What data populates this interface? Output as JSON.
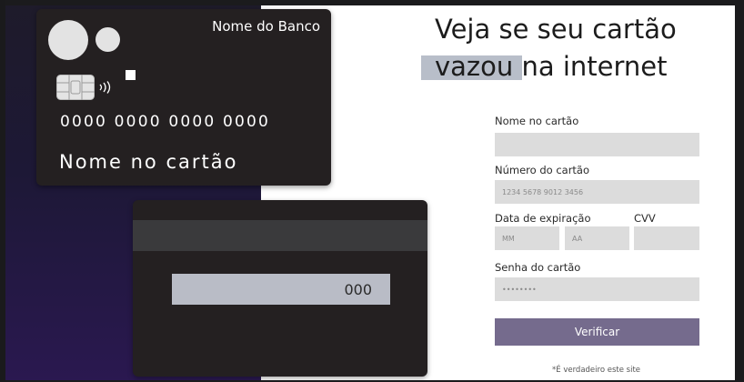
{
  "front_card": {
    "bank_name": "Nome do Banco",
    "number": "0000 0000 0000 0000",
    "name": "Nome no cartão"
  },
  "back_card": {
    "cvv": "000"
  },
  "heading": {
    "line1": "Veja se seu cartão",
    "line2_highlight": "vazou",
    "line2_rest": " na internet"
  },
  "form": {
    "name_label": "Nome no cartão",
    "name_value": "",
    "number_label": "Número do cartão",
    "number_placeholder": "1234 5678 9012 3456",
    "expiry_label": "Data de expiração",
    "cvv_label": "CVV",
    "month_placeholder": "MM",
    "year_placeholder": "AA",
    "cvv_value": "",
    "password_label": "Senha do cartão",
    "password_placeholder": "••••••••",
    "submit_label": "Verificar"
  },
  "footnote": "*É verdadeiro este site",
  "colors": {
    "card": "#242021",
    "button": "#756b8d",
    "field": "#dcdcdc",
    "highlight": "#b8bec9"
  }
}
